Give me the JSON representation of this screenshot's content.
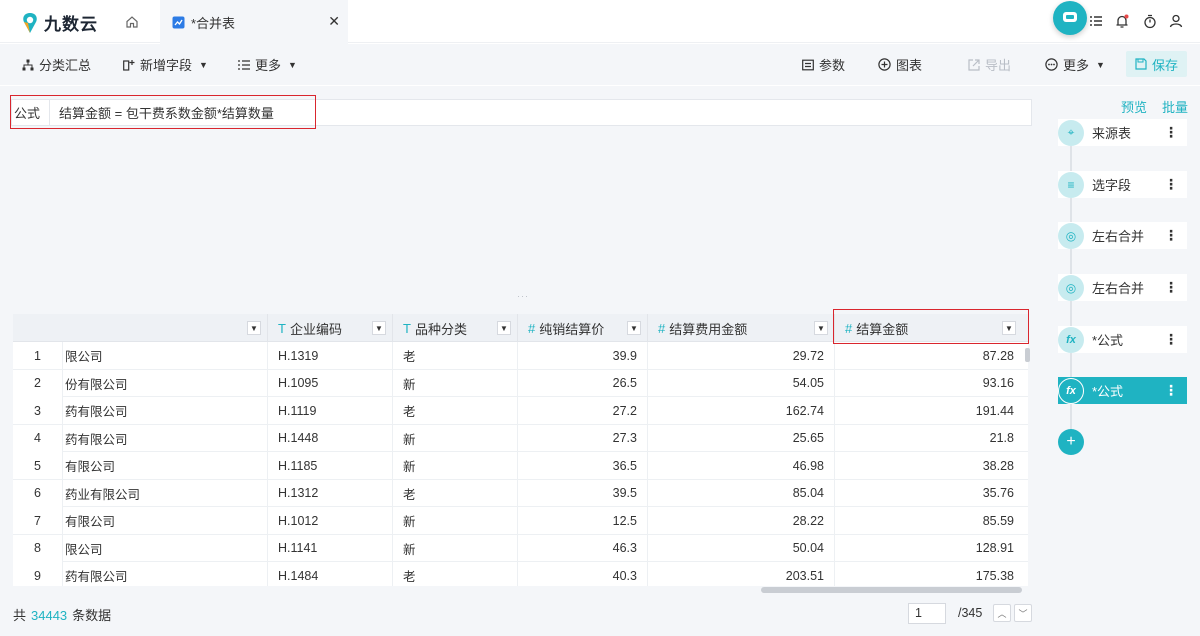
{
  "app": {
    "brand": "九数云"
  },
  "tabs": {
    "file_tab_label": "*合并表"
  },
  "toolbar": {
    "group_summary": "分类汇总",
    "add_field": "新增字段",
    "more_left": "更多",
    "params": "参数",
    "chart": "图表",
    "export": "导出",
    "more_right": "更多",
    "save": "保存"
  },
  "formula": {
    "label": "公式",
    "expression": "结算金额 = 包干费系数金额*结算数量"
  },
  "table": {
    "columns": [
      {
        "type_icon": "",
        "name": ""
      },
      {
        "type_icon": "T",
        "name": "企业编码"
      },
      {
        "type_icon": "T",
        "name": "品种分类"
      },
      {
        "type_icon": "#",
        "name": "纯销结算价"
      },
      {
        "type_icon": "#",
        "name": "结算费用金额"
      },
      {
        "type_icon": "#",
        "name": "结算金额"
      }
    ],
    "rows": [
      {
        "idx": "1",
        "company": "限公司",
        "code": "H.1319",
        "category": "老",
        "price": "39.9",
        "fee": "29.72",
        "amount": "87.28"
      },
      {
        "idx": "2",
        "company": "份有限公司",
        "code": "H.1095",
        "category": "新",
        "price": "26.5",
        "fee": "54.05",
        "amount": "93.16"
      },
      {
        "idx": "3",
        "company": "药有限公司",
        "code": "H.1119",
        "category": "老",
        "price": "27.2",
        "fee": "162.74",
        "amount": "191.44"
      },
      {
        "idx": "4",
        "company": "药有限公司",
        "code": "H.1448",
        "category": "新",
        "price": "27.3",
        "fee": "25.65",
        "amount": "21.8"
      },
      {
        "idx": "5",
        "company": "有限公司",
        "code": "H.1185",
        "category": "新",
        "price": "36.5",
        "fee": "46.98",
        "amount": "38.28"
      },
      {
        "idx": "6",
        "company": "药业有限公司",
        "code": "H.1312",
        "category": "老",
        "price": "39.5",
        "fee": "85.04",
        "amount": "35.76"
      },
      {
        "idx": "7",
        "company": "有限公司",
        "code": "H.1012",
        "category": "新",
        "price": "12.5",
        "fee": "28.22",
        "amount": "85.59"
      },
      {
        "idx": "8",
        "company": "限公司",
        "code": "H.1141",
        "category": "新",
        "price": "46.3",
        "fee": "50.04",
        "amount": "128.91"
      },
      {
        "idx": "9",
        "company": "药有限公司",
        "code": "H.1484",
        "category": "老",
        "price": "40.3",
        "fee": "203.51",
        "amount": "175.38"
      }
    ]
  },
  "footer": {
    "prefix": "共",
    "total_rows": "34443",
    "suffix": "条数据",
    "current_page": "1",
    "total_pages": "/345"
  },
  "panel": {
    "preview": "预览",
    "batch": "批量",
    "steps": [
      {
        "label": "来源表",
        "icon": "source-icon"
      },
      {
        "label": "选字段",
        "icon": "select-fields-icon"
      },
      {
        "label": "左右合并",
        "icon": "merge-icon"
      },
      {
        "label": "左右合并",
        "icon": "merge-icon"
      },
      {
        "label": "*公式",
        "icon": "formula-icon"
      },
      {
        "label": "*公式",
        "icon": "formula-icon"
      }
    ]
  },
  "colors": {
    "accent": "#1fb3c2",
    "highlight": "#d9262e",
    "bg": "#f4f6f9"
  }
}
